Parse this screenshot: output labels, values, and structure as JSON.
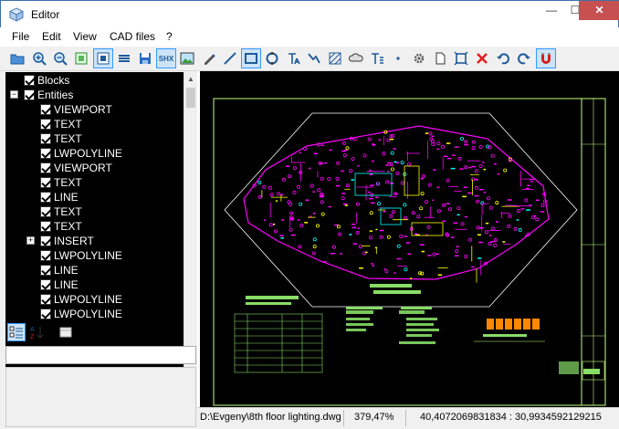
{
  "window": {
    "title": "Editor",
    "minimize": "—",
    "maximize": "☐",
    "close": "✕"
  },
  "menu": [
    "File",
    "Edit",
    "View",
    "CAD files",
    "?"
  ],
  "toolbar": {
    "shx_label": "SHX",
    "icons": [
      "open-folder-icon",
      "zoom-in-icon",
      "zoom-out-icon",
      "zoom-extents-icon",
      "model-view-icon",
      "layers-icon",
      "save-icon",
      "shx-font-icon",
      "raster-image-icon",
      "pencil-icon",
      "line-icon",
      "rectangle-icon",
      "circle-icon",
      "text-icon",
      "polyline-icon",
      "hatch-icon",
      "clouds-icon",
      "mtext-icon",
      "point-icon",
      "settings-icon",
      "page-icon",
      "fit-icon",
      "delete-icon",
      "undo-icon",
      "redo-icon",
      "magnet-icon"
    ]
  },
  "tree": {
    "items": [
      {
        "label": "Blocks",
        "level": 0,
        "expander": "",
        "checked": true
      },
      {
        "label": "Entities",
        "level": 0,
        "expander": "−",
        "checked": true
      },
      {
        "label": "VIEWPORT",
        "level": 1,
        "expander": "",
        "checked": true
      },
      {
        "label": "TEXT",
        "level": 1,
        "expander": "",
        "checked": true
      },
      {
        "label": "TEXT",
        "level": 1,
        "expander": "",
        "checked": true
      },
      {
        "label": "LWPOLYLINE",
        "level": 1,
        "expander": "",
        "checked": true
      },
      {
        "label": "VIEWPORT",
        "level": 1,
        "expander": "",
        "checked": true
      },
      {
        "label": "TEXT",
        "level": 1,
        "expander": "",
        "checked": true
      },
      {
        "label": "LINE",
        "level": 1,
        "expander": "",
        "checked": true
      },
      {
        "label": "TEXT",
        "level": 1,
        "expander": "",
        "checked": true
      },
      {
        "label": "TEXT",
        "level": 1,
        "expander": "",
        "checked": true
      },
      {
        "label": "INSERT",
        "level": 1,
        "expander": "+",
        "checked": true
      },
      {
        "label": "LWPOLYLINE",
        "level": 1,
        "expander": "",
        "checked": true
      },
      {
        "label": "LINE",
        "level": 1,
        "expander": "",
        "checked": true
      },
      {
        "label": "LINE",
        "level": 1,
        "expander": "",
        "checked": true
      },
      {
        "label": "LWPOLYLINE",
        "level": 1,
        "expander": "",
        "checked": true
      },
      {
        "label": "LWPOLYLINE",
        "level": 1,
        "expander": "",
        "checked": true
      }
    ]
  },
  "properties": {
    "search_value": ""
  },
  "status": {
    "file_path": "D:\\Evgeny\\8th floor lighting.dwg",
    "zoom": "379,47%",
    "coords": "40,4072069831834 : 30,9934592129215"
  },
  "colors": {
    "canvas_bg": "#000000",
    "drawing_primary": "#ff00ff",
    "drawing_secondary": "#ffff00",
    "frame": "#c0ff80"
  }
}
